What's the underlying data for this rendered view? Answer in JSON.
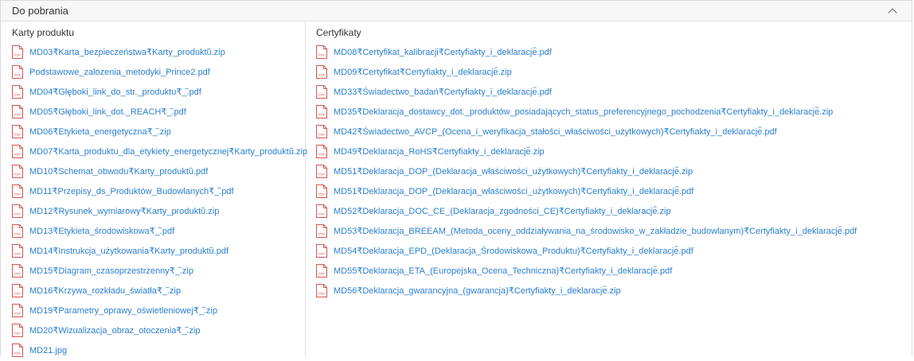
{
  "panel": {
    "title": "Do pobrania",
    "collapse_icon": "chevron-up-icon"
  },
  "file_icon": "pdf-file-icon",
  "colors": {
    "link": "#2a7fd0",
    "icon": "#d9534f"
  },
  "left": {
    "title": "Karty produktu",
    "items": [
      "MD03₹Karta_bezpieczeństwa₹Karty_produktu᷈.zip",
      "Podstawowe_zalozenia_metodyki_Prince2.pdf",
      "MD04₹Głęboki_link_do_str._produktu₹_᷈.pdf",
      "MD05₹Głęboki_link_dot._REACH₹_᷈.pdf",
      "MD06₹Etykieta_energetyczna₹_᷈.zip",
      "MD07₹Karta_produktu_dla_etykiety_energetycznej₹Karty_produktu᷈.zip",
      "MD10₹Schemat_obwodu₹Karty_produktu᷈.pdf",
      "MD11₹Przepisy_ds_Produktów_Budowlanych₹_᷈.pdf",
      "MD12₹Rysunek_wymiarowy₹Karty_produktu᷈.zip",
      "MD13₹Etykieta_środowiskowa₹_᷈.pdf",
      "MD14₹Instrukcja_użytkowania₹Karty_produktu᷈.pdf",
      "MD15₹Diagram_czasoprzestrzenny₹_᷈.zip",
      "MD16₹Krzywa_rozkładu_światła₹_᷈.zip",
      "MD19₹Parametry_oprawy_oświetleniowej₹_᷈.zip",
      "MD20₹Wizualizacja_obraz_otoczenia₹_᷈.zip",
      "MD21.jpg"
    ]
  },
  "right": {
    "title": "Certyfikaty",
    "items": [
      "MD08₹Certyfikat_kalibracji₹Certyfiakty_i_deklaracje᷈.pdf",
      "MD09₹Certyfikat₹Certyfiakty_i_deklaracje᷈.zip",
      "MD33₹Świadectwo_badań₹Certyfiakty_i_deklaracje᷈.pdf",
      "MD35₹Deklaracja_dostawcy_dot._produktów_posiadających_status_preferencyjnego_pochodzenia₹Certyfiakty_i_deklaracje᷈.zip",
      "MD42₹Świadectwo_AVCP_(Ocena_i_weryfikacja_stałości_właściwości_użytkowych)₹Certyfiakty_i_deklaracje᷈.pdf",
      "MD49₹Deklaracja_RoHS₹Certyfiakty_i_deklaracje᷈.zip",
      "MD51₹Deklaracja_DOP_(Deklaracja_właściwości_użytkowych)₹Certyfiakty_i_deklaracje᷈.zip",
      "MD51₹Deklaracja_DOP_(Deklaracja_właściwości_użytkowych)₹Certyfiakty_i_deklaracje᷈.pdf",
      "MD52₹Deklaracja_DOC_CE_(Deklaracja_zgodności_CE)₹Certyfiakty_i_deklaracje᷈.zip",
      "MD53₹Deklaracja_BREEAM_(Metoda_oceny_oddziaływania_na_środowisko_w_zakładzie_budowlanym)₹Certyfiakty_i_deklaracje᷈.pdf",
      "MD54₹Deklaracja_EPD_(Deklaracja_Środowiskowa_Produktu)₹Certyfiakty_i_deklaracje᷈.pdf",
      "MD55₹Deklaracja_ETA_(Europejska_Ocena_Techniczna)₹Certyfiakty_i_deklaracje᷈.pdf",
      "MD56₹Deklaracja_gwarancyjna_(gwarancja)₹Certyfiakty_i_deklaracje᷈.zip"
    ]
  }
}
